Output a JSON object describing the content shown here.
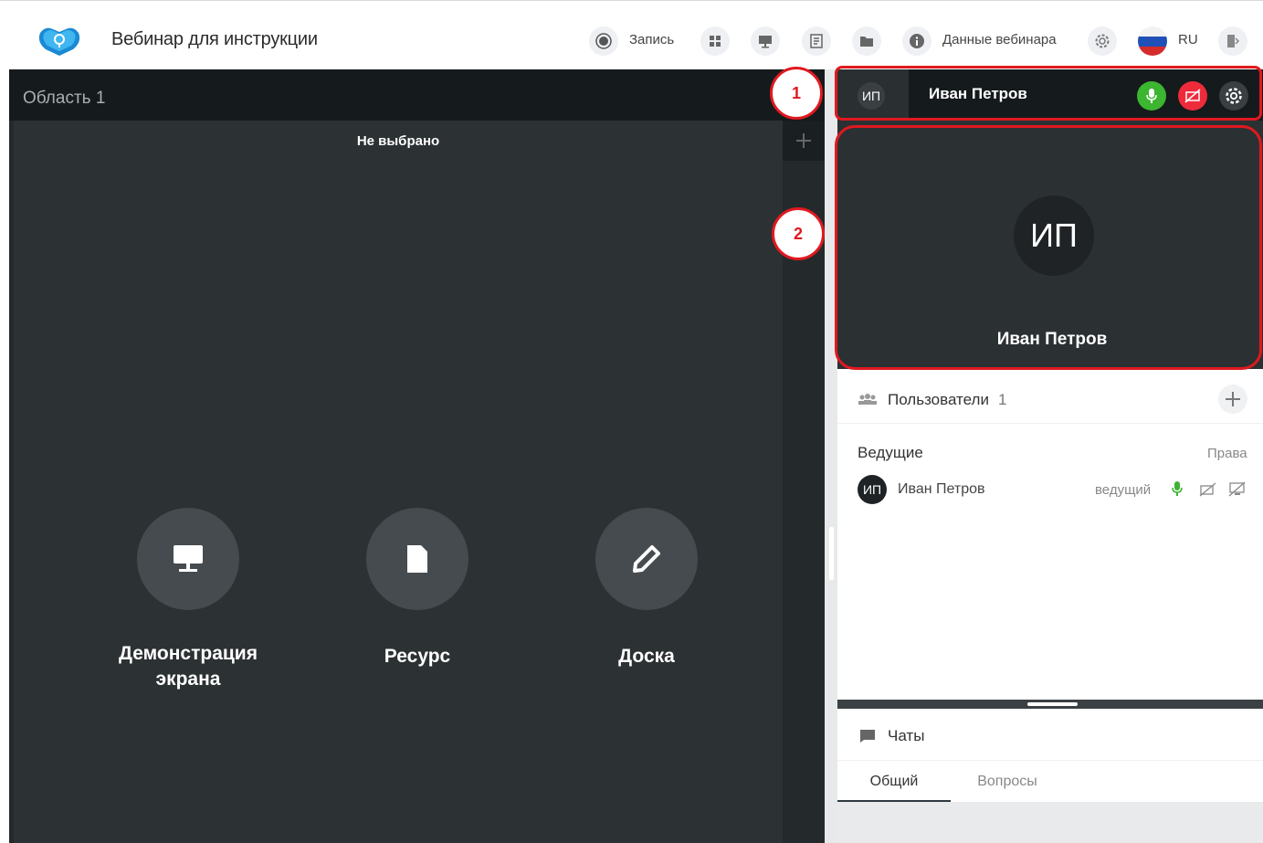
{
  "header": {
    "title": "Вебинар для инструкции",
    "record_label": "Запись",
    "webinar_data_label": "Данные вебинара",
    "language": "RU"
  },
  "left_area": {
    "title": "Область 1",
    "not_selected": "Не выбрано",
    "actions": [
      {
        "label_line1": "Демонстрация",
        "label_line2": "экрана",
        "icon": "monitor-icon"
      },
      {
        "label_line1": "Ресурс",
        "label_line2": "",
        "icon": "file-icon"
      },
      {
        "label_line1": "Доска",
        "label_line2": "",
        "icon": "pencil-icon"
      }
    ]
  },
  "user_bar": {
    "initials": "ИП",
    "name": "Иван Петров"
  },
  "video": {
    "initials": "ИП",
    "name": "Иван Петров"
  },
  "users": {
    "title": "Пользователи",
    "count": "1",
    "section": "Ведущие",
    "rights_label": "Права",
    "rows": [
      {
        "initials": "ИП",
        "name": "Иван Петров",
        "role": "ведущий"
      }
    ]
  },
  "chats": {
    "title": "Чаты",
    "tabs": [
      "Общий",
      "Вопросы"
    ]
  },
  "annotations": [
    "1",
    "2"
  ],
  "colors": {
    "accent_red": "#e0191f",
    "mic_green": "#3cb531",
    "cam_red": "#ee2b3b",
    "dark_bg": "#24292b"
  }
}
